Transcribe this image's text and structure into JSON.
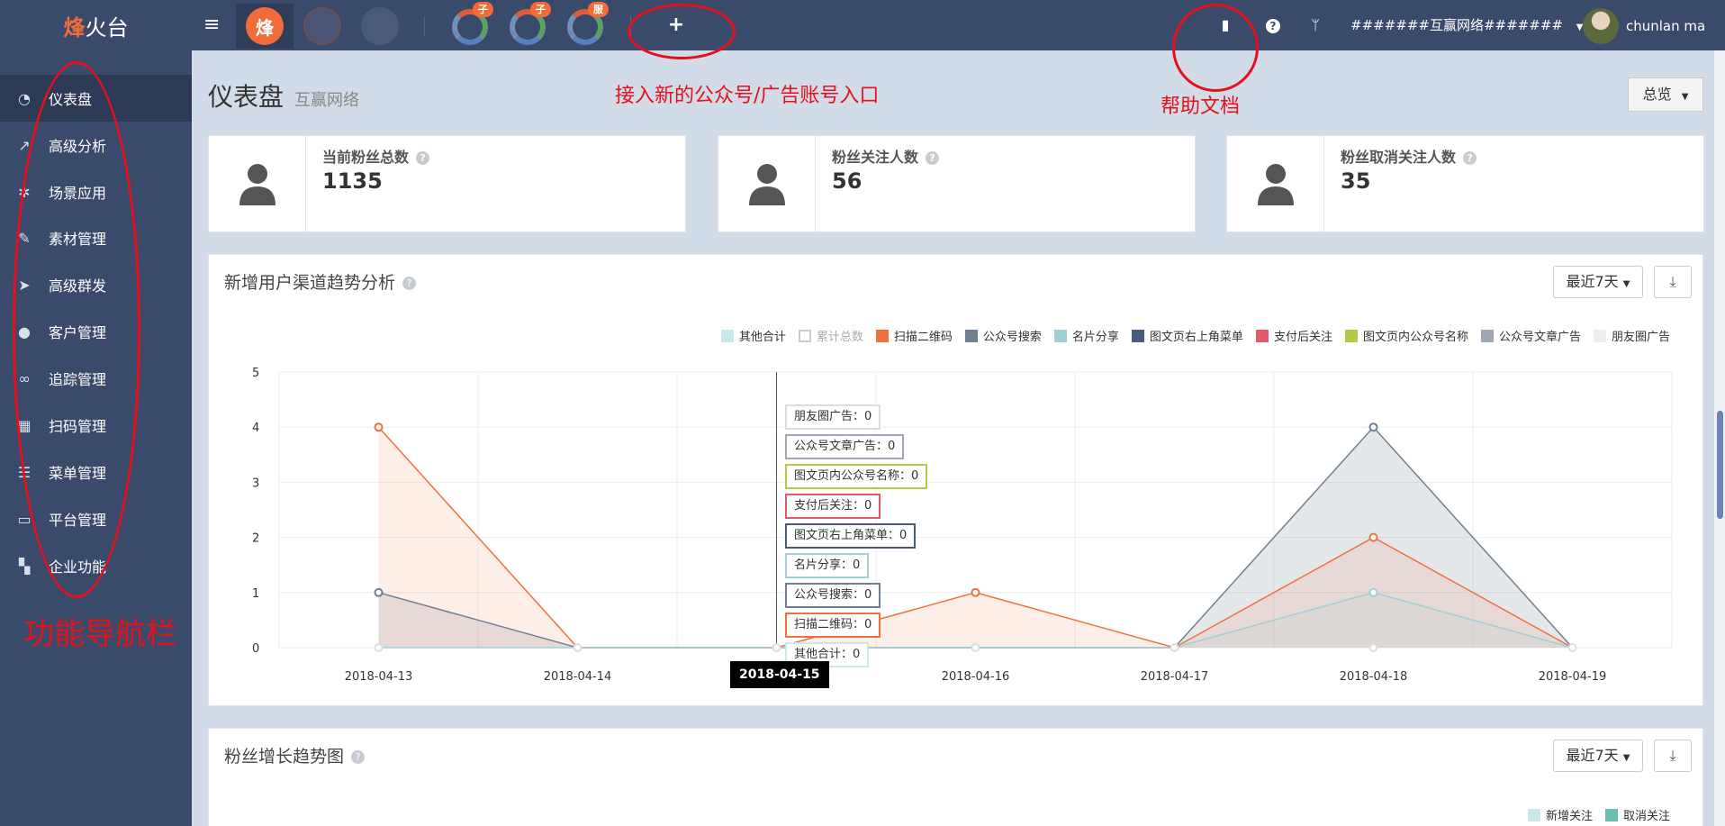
{
  "app": {
    "logo_fire": "烽",
    "logo_rest": "火台"
  },
  "topbar": {
    "badges": [
      "子",
      "子",
      "服"
    ],
    "plus_label": "+",
    "org_name": "#######互赢网络#######",
    "user_name": "chunlan ma"
  },
  "sidebar": {
    "items": [
      {
        "label": "仪表盘",
        "icon": "dashboard-icon"
      },
      {
        "label": "高级分析",
        "icon": "line-chart-icon"
      },
      {
        "label": "场景应用",
        "icon": "gears-icon"
      },
      {
        "label": "素材管理",
        "icon": "edit-icon"
      },
      {
        "label": "高级群发",
        "icon": "paper-plane-icon"
      },
      {
        "label": "客户管理",
        "icon": "user-icon"
      },
      {
        "label": "追踪管理",
        "icon": "link-icon"
      },
      {
        "label": "扫码管理",
        "icon": "qrcode-icon"
      },
      {
        "label": "菜单管理",
        "icon": "list-icon"
      },
      {
        "label": "平台管理",
        "icon": "desktop-icon"
      },
      {
        "label": "企业功能",
        "icon": "grid-icon"
      }
    ]
  },
  "header": {
    "title": "仪表盘",
    "subtitle": "互赢网络",
    "overview_btn": "总览"
  },
  "stats": [
    {
      "label": "当前粉丝总数",
      "value": "1135"
    },
    {
      "label": "粉丝关注人数",
      "value": "56"
    },
    {
      "label": "粉丝取消关注人数",
      "value": "35"
    }
  ],
  "channel_panel": {
    "title": "新增用户渠道趋势分析",
    "range": "最近7天"
  },
  "growth_panel": {
    "title": "粉丝增长趋势图",
    "range": "最近7天",
    "legend": [
      {
        "name": "新增关注",
        "color": "#c8e8ea"
      },
      {
        "name": "取消关注",
        "color": "#6cbfb0"
      }
    ]
  },
  "tooltip": {
    "date": "2018-04-15",
    "rows": [
      {
        "text": "朋友圈广告：0",
        "color": "#dddddd"
      },
      {
        "text": "公众号文章广告：0",
        "color": "#a0a8b8"
      },
      {
        "text": "图文页内公众号名称：0",
        "color": "#b5c84a"
      },
      {
        "text": "支付后关注：0",
        "color": "#e05a6a"
      },
      {
        "text": "图文页右上角菜单：0",
        "color": "#4a5a7a"
      },
      {
        "text": "名片分享：0",
        "color": "#a0d0d4"
      },
      {
        "text": "公众号搜索：0",
        "color": "#708090"
      },
      {
        "text": "扫描二维码：0",
        "color": "#f07040"
      },
      {
        "text": "其他合计：0",
        "color": "#c8eaec"
      }
    ]
  },
  "annotations": {
    "new_account": "接入新的公众号/广告账号入口",
    "help_doc": "帮助文档",
    "nav_bar": "功能导航栏"
  },
  "chart_data": {
    "type": "area",
    "x": [
      "2018-04-13",
      "2018-04-14",
      "2018-04-15",
      "2018-04-16",
      "2018-04-17",
      "2018-04-18",
      "2018-04-19"
    ],
    "ylim": [
      0,
      5
    ],
    "yticks": [
      "0",
      "1",
      "2",
      "3",
      "4",
      "5"
    ],
    "grid": true,
    "legend_position": "top-right",
    "series": [
      {
        "name": "其他合计",
        "color": "#c8eaec",
        "values": [
          0,
          0,
          0,
          0,
          0,
          0,
          0
        ]
      },
      {
        "name": "累计总数",
        "color": "#cccccc",
        "values": [],
        "hidden": true
      },
      {
        "name": "扫描二维码",
        "color": "#f07040",
        "values": [
          4,
          0,
          0,
          1,
          0,
          2,
          0
        ]
      },
      {
        "name": "公众号搜索",
        "color": "#708090",
        "values": [
          1,
          0,
          0,
          0,
          0,
          4,
          0
        ]
      },
      {
        "name": "名片分享",
        "color": "#a0d0d4",
        "values": [
          0,
          0,
          0,
          0,
          0,
          1,
          0
        ]
      },
      {
        "name": "图文页右上角菜单",
        "color": "#4a5a7a",
        "values": [
          0,
          0,
          0,
          0,
          0,
          0,
          0
        ]
      },
      {
        "name": "支付后关注",
        "color": "#e05a6a",
        "values": [
          0,
          0,
          0,
          0,
          0,
          0,
          0
        ]
      },
      {
        "name": "图文页内公众号名称",
        "color": "#b5c84a",
        "values": [
          0,
          0,
          0,
          0,
          0,
          0,
          0
        ]
      },
      {
        "name": "公众号文章广告",
        "color": "#a0a8b8",
        "values": [
          0,
          0,
          0,
          0,
          0,
          0,
          0
        ]
      },
      {
        "name": "朋友圈广告",
        "color": "#eeeeee",
        "values": [
          0,
          0,
          0,
          0,
          0,
          0,
          0
        ]
      }
    ]
  }
}
